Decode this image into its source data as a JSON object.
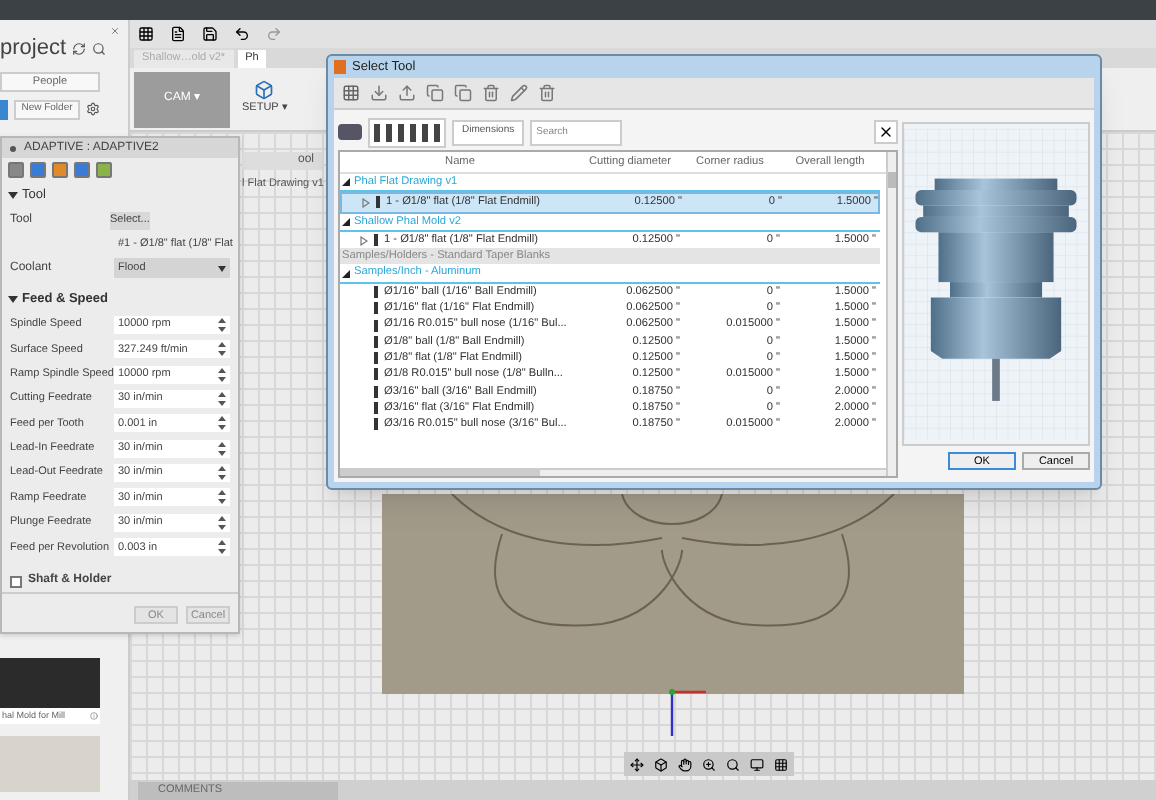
{
  "data_panel": {
    "title": "project",
    "people_button": "People",
    "new_folder_button": "New Folder",
    "card_label": "hal Mold for Mill"
  },
  "toolbar": {
    "document_tabs": [
      {
        "label": "Shallow…old v2*",
        "selected": false
      },
      {
        "label": "Ph",
        "selected": true
      }
    ],
    "workspace": "CAM ▾",
    "setup": "SETUP ▾"
  },
  "browser": {
    "labels": [
      "ool",
      "l Flat Drawing v1"
    ]
  },
  "comments": "COMMENTS",
  "adaptive_dialog": {
    "title": "ADAPTIVE : ADAPTIVE2",
    "tool_section": {
      "title": "Tool",
      "expanded": true,
      "tool_label": "Tool",
      "select_button": "Select...",
      "tool_name": "#1 - Ø1/8\" flat (1/8\" Flat",
      "coolant_label": "Coolant",
      "coolant_value": "Flood"
    },
    "feed_section": {
      "title": "Feed & Speed",
      "expanded": true,
      "fields": [
        {
          "label": "Spindle Speed",
          "value": "10000 rpm"
        },
        {
          "label": "Surface Speed",
          "value": "327.249 ft/min"
        },
        {
          "label": "Ramp Spindle Speed",
          "value": "10000 rpm"
        },
        {
          "label": "Cutting Feedrate",
          "value": "30 in/min"
        },
        {
          "label": "Feed per Tooth",
          "value": "0.001 in"
        },
        {
          "label": "Lead-In Feedrate",
          "value": "30 in/min"
        },
        {
          "label": "Lead-Out Feedrate",
          "value": "30 in/min"
        },
        {
          "label": "Ramp Feedrate",
          "value": "30 in/min"
        },
        {
          "label": "Plunge Feedrate",
          "value": "30 in/min"
        },
        {
          "label": "Feed per Revolution",
          "value": "0.003 in"
        }
      ]
    },
    "shaft_holder": {
      "label": "Shaft & Holder",
      "checked": false
    },
    "buttons": [
      "OK",
      "Cancel"
    ]
  },
  "select_tool": {
    "title": "Select Tool",
    "dimensions_button": "Dimensions",
    "search": {
      "placeholder": "Search"
    },
    "columns": [
      "Name",
      "Cutting diameter",
      "Corner radius",
      "Overall length"
    ],
    "groups": [
      {
        "name": "Phal Flat Drawing v1",
        "expanded": true,
        "tools": [
          {
            "name": "1 - Ø1/8\" flat (1/8\" Flat Endmill)",
            "diameter": "0.12500 \"",
            "radius": "0 \"",
            "length": "1.5000 \"",
            "expandable": true,
            "selected": true
          }
        ]
      },
      {
        "name": "Shallow Phal Mold v2",
        "expanded": true,
        "tools": [
          {
            "name": "1 - Ø1/8\" flat (1/8\" Flat Endmill)",
            "diameter": "0.12500 \"",
            "radius": "0 \"",
            "length": "1.5000 \"",
            "expandable": true,
            "selected": false
          }
        ]
      },
      {
        "name": "Samples/Holders - Standard Taper Blanks",
        "expanded": false
      },
      {
        "name": "Samples/Inch - Aluminum",
        "expanded": true,
        "tools": [
          {
            "name": "Ø1/16\" ball (1/16\" Ball Endmill)",
            "diameter": "0.062500 \"",
            "radius": "0 \"",
            "length": "1.5000 \"",
            "expandable": false,
            "selected": false
          },
          {
            "name": "Ø1/16\" flat (1/16\" Flat Endmill)",
            "diameter": "0.062500 \"",
            "radius": "0 \"",
            "length": "1.5000 \"",
            "expandable": false,
            "selected": false
          },
          {
            "name": "Ø1/16 R0.015\" bull nose (1/16\" Bul...",
            "diameter": "0.062500 \"",
            "radius": "0.015000 \"",
            "length": "1.5000 \"",
            "expandable": false,
            "selected": false
          },
          {
            "name": "Ø1/8\" ball (1/8\" Ball Endmill)",
            "diameter": "0.12500 \"",
            "radius": "0 \"",
            "length": "1.5000 \"",
            "expandable": false,
            "selected": false
          },
          {
            "name": "Ø1/8\" flat (1/8\" Flat Endmill)",
            "diameter": "0.12500 \"",
            "radius": "0 \"",
            "length": "1.5000 \"",
            "expandable": false,
            "selected": false
          },
          {
            "name": "Ø1/8 R0.015\" bull nose (1/8\" Bulln...",
            "diameter": "0.12500 \"",
            "radius": "0.015000 \"",
            "length": "1.5000 \"",
            "expandable": false,
            "selected": false
          },
          {
            "name": "Ø3/16\" ball (3/16\" Ball Endmill)",
            "diameter": "0.18750 \"",
            "radius": "0 \"",
            "length": "2.0000 \"",
            "expandable": false,
            "selected": false
          },
          {
            "name": "Ø3/16\" flat (3/16\" Flat Endmill)",
            "diameter": "0.18750 \"",
            "radius": "0 \"",
            "length": "2.0000 \"",
            "expandable": false,
            "selected": false
          },
          {
            "name": "Ø3/16 R0.015\" bull nose (3/16\" Bul...",
            "diameter": "0.18750 \"",
            "radius": "0.015000 \"",
            "length": "2.0000 \"",
            "expandable": false,
            "selected": false
          }
        ]
      }
    ],
    "buttons": [
      "OK",
      "Cancel"
    ]
  }
}
